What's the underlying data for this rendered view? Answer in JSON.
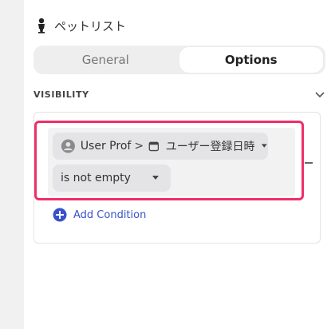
{
  "panel": {
    "title": "ペットリスト"
  },
  "tabs": [
    {
      "label": "General",
      "active": false
    },
    {
      "label": "Options",
      "active": true
    }
  ],
  "visibility": {
    "section_title": "VISIBILITY",
    "condition": {
      "field_source": "User Prof",
      "separator": ">",
      "field_name": "ユーザー登録日時",
      "operator": "is not empty"
    },
    "add_condition_label": "Add Condition"
  },
  "colors": {
    "highlight": "#f02e6a",
    "link": "#3a52c9",
    "pill_bg": "#e4e4e6"
  },
  "icons": {
    "title": "person-figure-icon",
    "section_toggle": "chevron-down-icon",
    "field_source": "avatar-icon",
    "field_type": "calendar-icon",
    "add": "plus-circle-icon"
  }
}
